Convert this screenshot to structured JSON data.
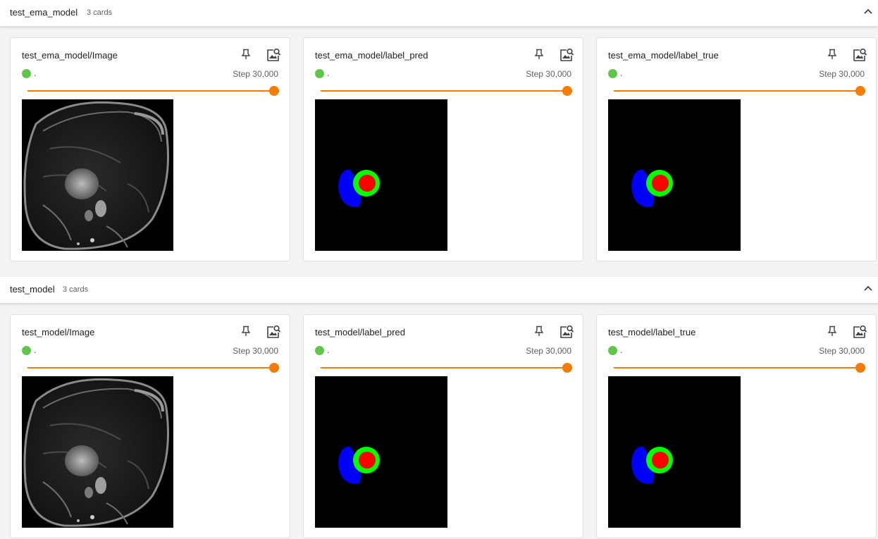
{
  "groups": [
    {
      "title": "test_ema_model",
      "count": "3 cards",
      "cards": [
        {
          "title": "test_ema_model/Image",
          "run": ".",
          "step": "Step 30,000",
          "image": "mri-scan"
        },
        {
          "title": "test_ema_model/label_pred",
          "run": ".",
          "step": "Step 30,000",
          "image": "segmentation-mask"
        },
        {
          "title": "test_ema_model/label_true",
          "run": ".",
          "step": "Step 30,000",
          "image": "segmentation-mask"
        }
      ]
    },
    {
      "title": "test_model",
      "count": "3 cards",
      "cards": [
        {
          "title": "test_model/Image",
          "run": ".",
          "step": "Step 30,000",
          "image": "mri-scan"
        },
        {
          "title": "test_model/label_pred",
          "run": ".",
          "step": "Step 30,000",
          "image": "segmentation-mask"
        },
        {
          "title": "test_model/label_true",
          "run": ".",
          "step": "Step 30,000",
          "image": "segmentation-mask"
        }
      ]
    }
  ],
  "slider": {
    "value_fraction": 1.0
  },
  "colors": {
    "accent": "#f57c00",
    "run_dot": "#5fc748",
    "mask_blue": "#0000ff",
    "mask_green": "#00ff00",
    "mask_red": "#ff0000"
  },
  "icons": {
    "collapse": "chevron-up-icon",
    "pin": "pin-icon",
    "zoom": "image-search-icon"
  }
}
